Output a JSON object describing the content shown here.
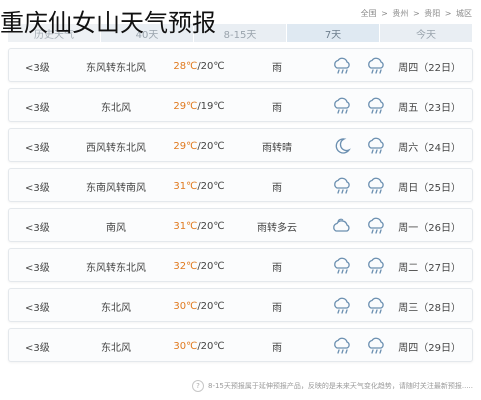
{
  "page_title": "重庆仙女山天气预报",
  "breadcrumb": [
    "全国",
    "贵州",
    "贵阳",
    "城区"
  ],
  "breadcrumb_sep": ">",
  "tabs": [
    {
      "label": "历史天气",
      "state": "hist"
    },
    {
      "label": "40天",
      "state": ""
    },
    {
      "label": "8-15天",
      "state": ""
    },
    {
      "label": "7天",
      "state": "active"
    },
    {
      "label": "今天",
      "state": ""
    }
  ],
  "days": [
    {
      "wind_level": "<3级",
      "wind_dir": "东风转东北风",
      "temp_hi": "28℃",
      "temp_lo": "/20℃",
      "condition": "雨",
      "icon_day": "rain-cloud-icon",
      "icon_night": "rain-cloud-icon",
      "day": "周四",
      "date": "（22日）"
    },
    {
      "wind_level": "<3级",
      "wind_dir": "东北风",
      "temp_hi": "29℃",
      "temp_lo": "/19℃",
      "condition": "雨",
      "icon_day": "rain-cloud-icon",
      "icon_night": "rain-cloud-icon",
      "day": "周五",
      "date": "（23日）"
    },
    {
      "wind_level": "<3级",
      "wind_dir": "西风转东北风",
      "temp_hi": "29℃",
      "temp_lo": "/20℃",
      "condition": "雨转晴",
      "icon_day": "rain-cloud-icon",
      "icon_night": "moon-icon",
      "day": "周六",
      "date": "（24日）"
    },
    {
      "wind_level": "<3级",
      "wind_dir": "东南风转南风",
      "temp_hi": "31℃",
      "temp_lo": "/20℃",
      "condition": "雨",
      "icon_day": "rain-cloud-icon",
      "icon_night": "rain-cloud-icon",
      "day": "周日",
      "date": "（25日）"
    },
    {
      "wind_level": "<3级",
      "wind_dir": "南风",
      "temp_hi": "31℃",
      "temp_lo": "/20℃",
      "condition": "雨转多云",
      "icon_day": "rain-cloud-icon",
      "icon_night": "cloud-icon",
      "day": "周一",
      "date": "（26日）"
    },
    {
      "wind_level": "<3级",
      "wind_dir": "东风转东北风",
      "temp_hi": "32℃",
      "temp_lo": "/20℃",
      "condition": "雨",
      "icon_day": "rain-cloud-icon",
      "icon_night": "rain-cloud-icon",
      "day": "周二",
      "date": "（27日）"
    },
    {
      "wind_level": "<3级",
      "wind_dir": "东北风",
      "temp_hi": "30℃",
      "temp_lo": "/20℃",
      "condition": "雨",
      "icon_day": "rain-cloud-icon",
      "icon_night": "rain-cloud-icon",
      "day": "周三",
      "date": "（28日）"
    },
    {
      "wind_level": "<3级",
      "wind_dir": "东北风",
      "temp_hi": "30℃",
      "temp_lo": "/20℃",
      "condition": "雨",
      "icon_day": "rain-cloud-icon",
      "icon_night": "rain-cloud-icon",
      "day": "周四",
      "date": "（29日）"
    }
  ],
  "footer": {
    "info_glyph": "?",
    "text": "8-15天预报属于延伸预报产品，反映的是未来天气变化趋势，请随时关注最新预报....."
  },
  "colors": {
    "temp_high": "#e07a1f",
    "tab_bg": "#e9eef3",
    "icon_stroke": "#6b8fb0"
  }
}
